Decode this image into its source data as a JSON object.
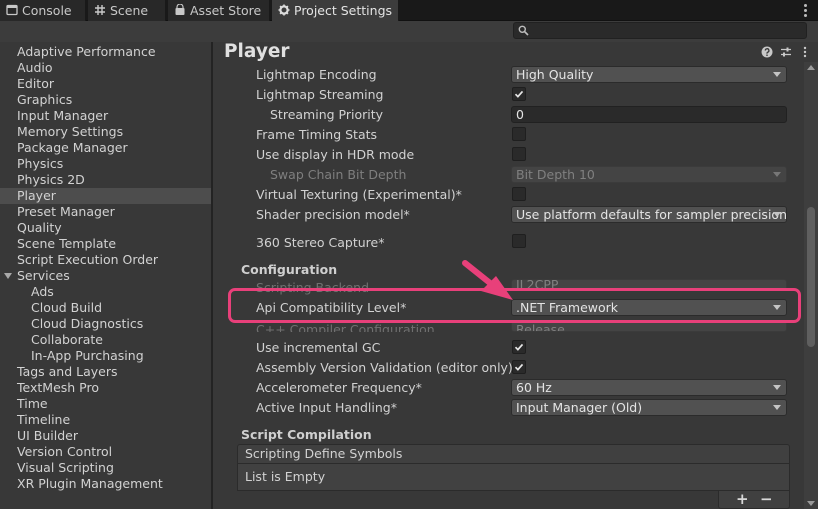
{
  "tabs": [
    {
      "label": "Console",
      "icon": "console-icon"
    },
    {
      "label": "Scene",
      "icon": "scene-grid-icon"
    },
    {
      "label": "Asset Store",
      "icon": "asset-store-icon"
    },
    {
      "label": "Project Settings",
      "icon": "gear-icon",
      "active": true
    }
  ],
  "search": {
    "placeholder": "",
    "value": ""
  },
  "sidebar": {
    "items": [
      {
        "label": "Adaptive Performance"
      },
      {
        "label": "Audio"
      },
      {
        "label": "Editor"
      },
      {
        "label": "Graphics"
      },
      {
        "label": "Input Manager"
      },
      {
        "label": "Memory Settings"
      },
      {
        "label": "Package Manager"
      },
      {
        "label": "Physics"
      },
      {
        "label": "Physics 2D"
      },
      {
        "label": "Player",
        "selected": true
      },
      {
        "label": "Preset Manager"
      },
      {
        "label": "Quality"
      },
      {
        "label": "Scene Template"
      },
      {
        "label": "Script Execution Order"
      },
      {
        "label": "Services",
        "expanded": true
      },
      {
        "label": "Ads",
        "child": true
      },
      {
        "label": "Cloud Build",
        "child": true
      },
      {
        "label": "Cloud Diagnostics",
        "child": true
      },
      {
        "label": "Collaborate",
        "child": true
      },
      {
        "label": "In-App Purchasing",
        "child": true
      },
      {
        "label": "Tags and Layers"
      },
      {
        "label": "TextMesh Pro"
      },
      {
        "label": "Time"
      },
      {
        "label": "Timeline"
      },
      {
        "label": "UI Builder"
      },
      {
        "label": "Version Control"
      },
      {
        "label": "Visual Scripting"
      },
      {
        "label": "XR Plugin Management"
      }
    ]
  },
  "main": {
    "title": "Player",
    "rendering": {
      "lightmap_encoding": {
        "label": "Lightmap Encoding",
        "value": "High Quality"
      },
      "lightmap_streaming": {
        "label": "Lightmap Streaming",
        "checked": true
      },
      "streaming_priority": {
        "label": "Streaming Priority",
        "value": "0"
      },
      "frame_timing_stats": {
        "label": "Frame Timing Stats",
        "checked": false
      },
      "hdr_display": {
        "label": "Use display in HDR mode",
        "checked": false
      },
      "swap_chain_bit_depth": {
        "label": "Swap Chain Bit Depth",
        "value": "Bit Depth 10"
      },
      "virtual_texturing": {
        "label": "Virtual Texturing (Experimental)*",
        "checked": false
      },
      "shader_precision": {
        "label": "Shader precision model*",
        "value": "Use platform defaults for sampler precision"
      },
      "stereo_capture": {
        "label": "360 Stereo Capture*",
        "checked": false
      }
    },
    "configuration": {
      "heading": "Configuration",
      "scripting_backend": {
        "label": "Scripting Backend",
        "value": "IL2CPP"
      },
      "api_compat": {
        "label": "Api Compatibility Level*",
        "value": ".NET Framework"
      },
      "cpp_compiler": {
        "label": "C++ Compiler Configuration",
        "value": "Release"
      },
      "incremental_gc": {
        "label": "Use incremental GC",
        "checked": true
      },
      "assembly_validation": {
        "label": "Assembly Version Validation (editor only)",
        "checked": true
      },
      "accelerometer_freq": {
        "label": "Accelerometer Frequency*",
        "value": "60 Hz"
      },
      "active_input": {
        "label": "Active Input Handling*",
        "value": "Input Manager (Old)"
      }
    },
    "script_compilation": {
      "heading": "Script Compilation",
      "define_symbols": "Scripting Define Symbols",
      "list_empty": "List is Empty",
      "add": "+",
      "remove": "−"
    }
  },
  "colors": {
    "highlight": "#e8407a",
    "background": "#383838",
    "selected": "#4d4d4d"
  }
}
